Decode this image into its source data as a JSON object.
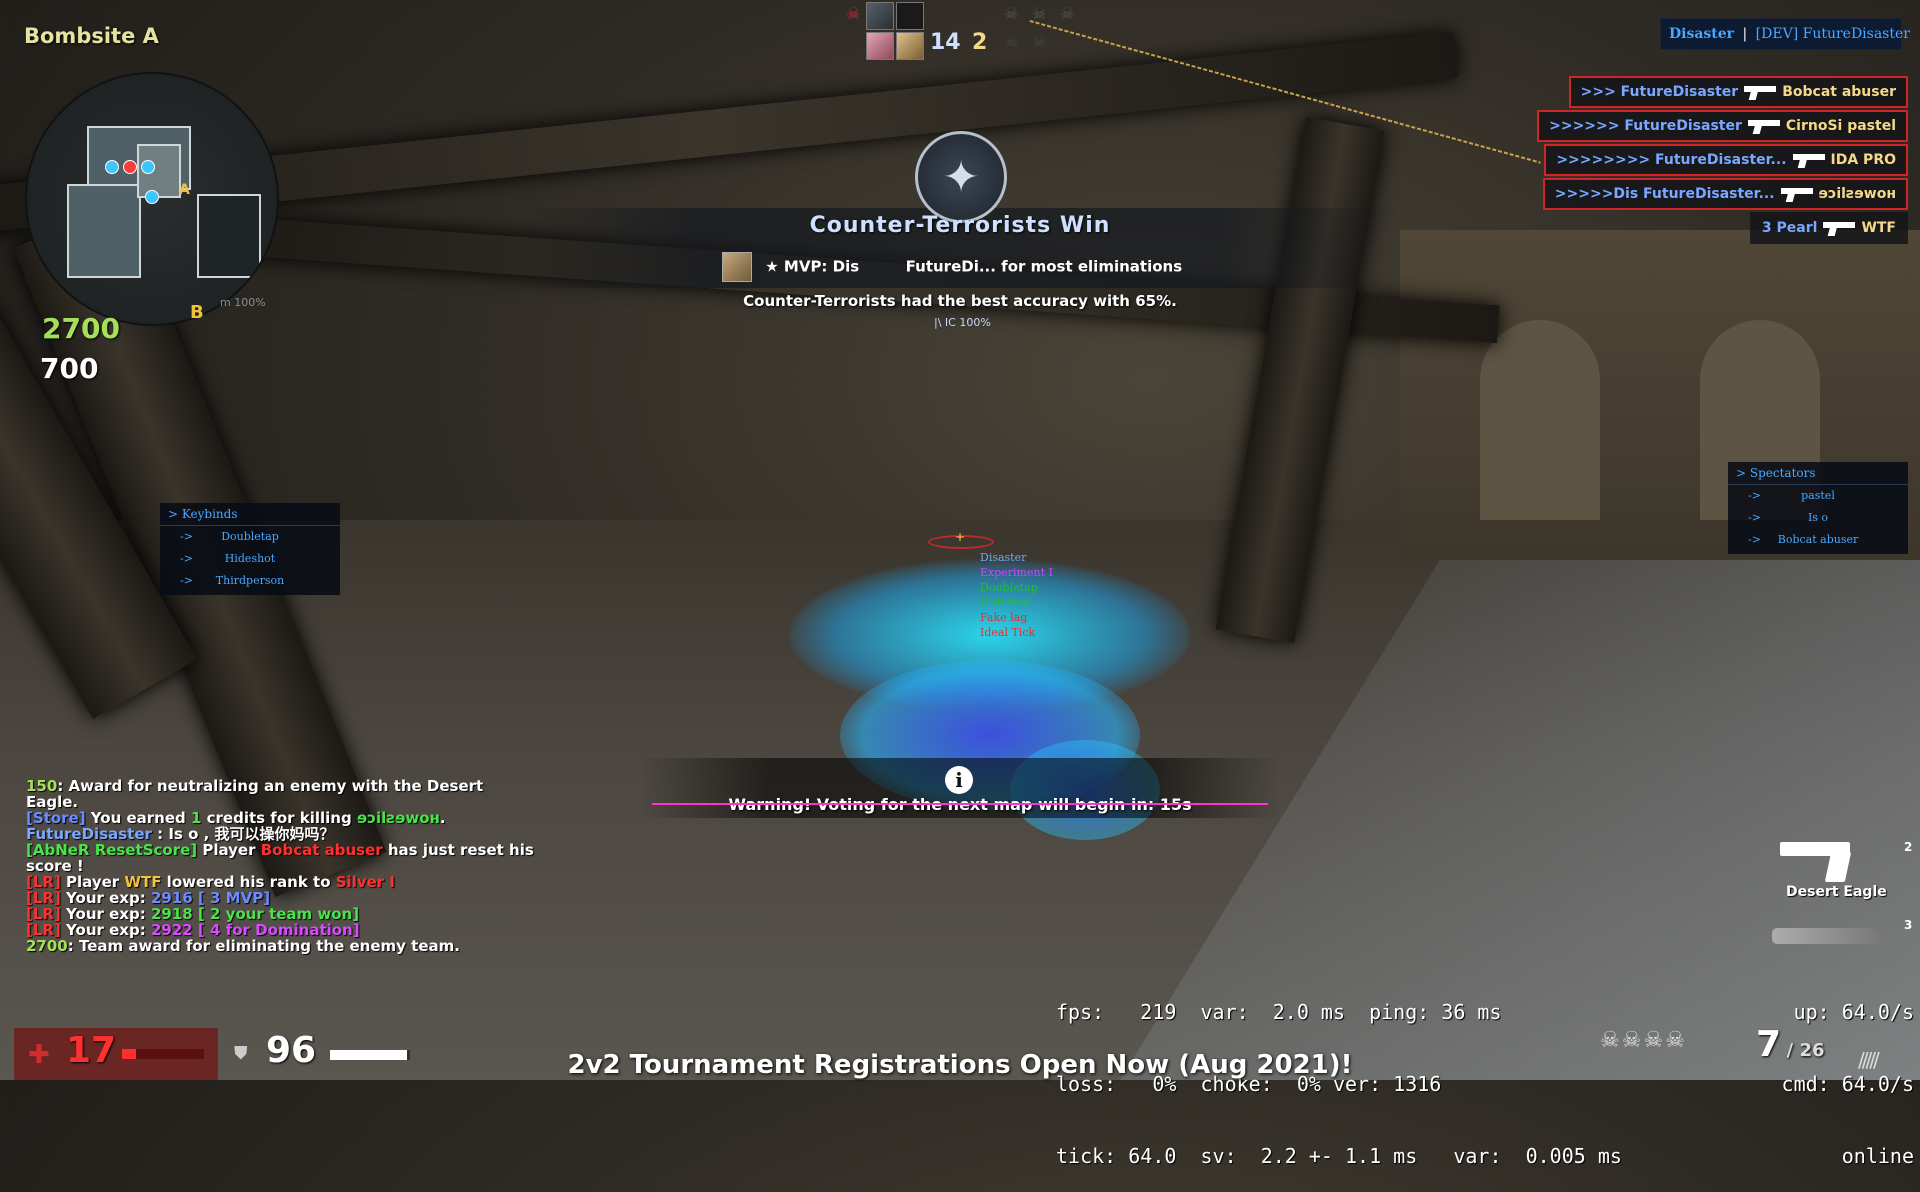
{
  "hud": {
    "bombsite": "Bombsite A",
    "money_team": "2700",
    "money_self": "700",
    "radar_marker_a": "A",
    "radar_marker_b": "B",
    "radar_ghost": "m 100%"
  },
  "scoreboard": {
    "ct_score": "14",
    "t_score": "2"
  },
  "round_end": {
    "title": "Counter-Terrorists Win",
    "mvp_label": "★ MVP: Dis",
    "mvp_reason": "FutureDi... for most eliminations",
    "accuracy_text": "Counter-Terrorists had the best accuracy with 65%.",
    "ct_tag": "|\\ IC 100%"
  },
  "brand": {
    "name": "Disaster",
    "separator": "|",
    "tag": "[DEV] FutureDisaster"
  },
  "killfeed": [
    {
      "killer": ">>> FutureDisaster",
      "victim": "Bobcat abuser",
      "highlight": true
    },
    {
      "killer": ">>>>>> FutureDisaster",
      "victim": "CirnoSi pastel",
      "highlight": true
    },
    {
      "killer": ">>>>>>>> FutureDisaster...",
      "victim": "IDA PRO",
      "highlight": true
    },
    {
      "killer": ">>>>>Dis FutureDisaster...",
      "victim": "ɘɔilƨɘwoʜ",
      "highlight": true
    },
    {
      "killer": "3 Pearl",
      "victim": "WTF",
      "highlight": false
    }
  ],
  "keybinds": {
    "title": "> Keybinds",
    "arrow": "->",
    "items": [
      "Doubletap",
      "Hideshot",
      "Thirdperson"
    ]
  },
  "spectators": {
    "title": "> Spectators",
    "arrow": "->",
    "items": [
      "pastel",
      "Is o",
      "Bobcat abuser"
    ]
  },
  "esp_labels": [
    {
      "text": "Disaster",
      "color": "#6fa8ff"
    },
    {
      "text": "Experiment I",
      "color": "#c04bff"
    },
    {
      "text": "Doubletap",
      "color": "#20c030"
    },
    {
      "text": "Hideshot",
      "color": "#20c030"
    },
    {
      "text": "Fake lag",
      "color": "#e03030"
    },
    {
      "text": "Ideal Tick",
      "color": "#e03030"
    }
  ],
  "chat": [
    {
      "parts": [
        {
          "t": "150",
          "c": "#a6e05a"
        },
        {
          "t": ": Award for neutralizing an enemy with the Desert",
          "c": "#ffffff"
        }
      ]
    },
    {
      "parts": [
        {
          "t": "Eagle.",
          "c": "#ffffff"
        }
      ]
    },
    {
      "parts": [
        {
          "t": "[Store]",
          "c": "#6b8cff"
        },
        {
          "t": " You earned ",
          "c": "#ffffff"
        },
        {
          "t": "1",
          "c": "#4be34b"
        },
        {
          "t": " credits for killing ",
          "c": "#ffffff"
        },
        {
          "t": "ɘɔilƨɘwoʜ",
          "c": "#4be34b"
        },
        {
          "t": ".",
          "c": "#ffffff"
        }
      ]
    },
    {
      "parts": [
        {
          "t": "FutureDisaster",
          "c": "#7aa7ff"
        },
        {
          "t": " : Is o , 我可以操你妈吗？",
          "c": "#ffffff"
        }
      ]
    },
    {
      "parts": [
        {
          "t": "[AbNeR ResetScore]",
          "c": "#4be34b"
        },
        {
          "t": " Player ",
          "c": "#ffffff"
        },
        {
          "t": "Bobcat abuser",
          "c": "#ff3030"
        },
        {
          "t": " has just reset his",
          "c": "#ffffff"
        }
      ]
    },
    {
      "parts": [
        {
          "t": "score !",
          "c": "#ffffff"
        }
      ]
    },
    {
      "parts": [
        {
          "t": "[LR]",
          "c": "#ff3030"
        },
        {
          "t": " Player ",
          "c": "#ffffff"
        },
        {
          "t": "WTF",
          "c": "#f0c23a"
        },
        {
          "t": " lowered his rank to ",
          "c": "#ffffff"
        },
        {
          "t": "Silver I",
          "c": "#ff3030"
        }
      ]
    },
    {
      "parts": [
        {
          "t": "[LR]",
          "c": "#ff3030"
        },
        {
          "t": " Your exp: ",
          "c": "#ffffff"
        },
        {
          "t": "2916",
          "c": "#6b8cff"
        },
        {
          "t": " [ 3 MVP]",
          "c": "#6b8cff"
        }
      ]
    },
    {
      "parts": [
        {
          "t": "[LR]",
          "c": "#ff3030"
        },
        {
          "t": " Your exp: ",
          "c": "#ffffff"
        },
        {
          "t": "2918",
          "c": "#4be34b"
        },
        {
          "t": " [ 2 your team won]",
          "c": "#4be34b"
        }
      ]
    },
    {
      "parts": [
        {
          "t": "[LR]",
          "c": "#ff3030"
        },
        {
          "t": " Your exp: ",
          "c": "#ffffff"
        },
        {
          "t": "2922",
          "c": "#d84bff"
        },
        {
          "t": " [ 4 for Domination]",
          "c": "#d84bff"
        }
      ]
    },
    {
      "parts": [
        {
          "t": "2700",
          "c": "#a6e05a"
        },
        {
          "t": ": Team award for eliminating the enemy team.",
          "c": "#ffffff"
        }
      ]
    }
  ],
  "vote_warning": "Warning! Voting for the next map will begin in: 15s",
  "netgraph": {
    "line1": "fps:   219  var:  2.0 ms  ping: 36 ms",
    "line2": "loss:   0%  choke:  0% ver: 1316",
    "line3": "tick: 64.0  sv:  2.2 +- 1.1 ms   var:  0.005 ms",
    "right1": "up: 64.0/s",
    "right2": "cmd: 64.0/s",
    "right3": "online"
  },
  "player": {
    "health": "17",
    "health_fraction": 0.17,
    "armor": "96",
    "armor_fraction": 0.96,
    "ammo_clip": "7",
    "ammo_reserve": "/ 26",
    "bullet_icons": "/////",
    "weapon_name": "Desert Eagle",
    "slot_primary": "2",
    "slot_knife": "3"
  },
  "tournament_banner": "2v2 Tournament Registrations Open Now (Aug 2021)!",
  "colors": {
    "ct_blue": "#cfe0ff",
    "accent_cyan": "#3ec5ff",
    "killfeed_border": "#d12424",
    "cheat_panel_text": "#4aa8ff",
    "health_red": "#ff3030",
    "money_green": "#a6e05a"
  }
}
